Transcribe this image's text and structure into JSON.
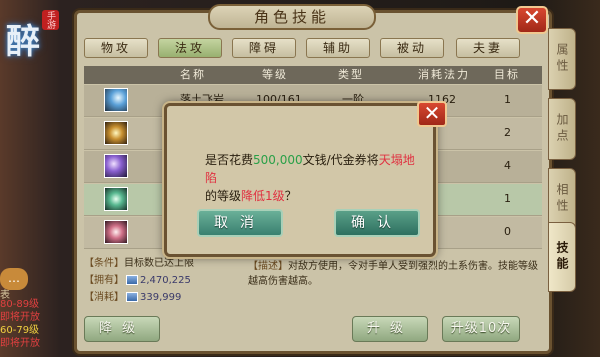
{
  "game": {
    "logo_glyph": "醉",
    "logo_badge": "手游"
  },
  "left": {
    "chat_icon": "…",
    "tab": "表",
    "lines": [
      {
        "text": "80-89级",
        "color": "red"
      },
      {
        "text": "即将开放",
        "color": "red"
      },
      {
        "text": "60-79级",
        "color": "yellow"
      },
      {
        "text": "即将开放",
        "color": "red"
      }
    ]
  },
  "panel": {
    "title": "角色技能",
    "close_glyph": "✕",
    "tabs": [
      "物攻",
      "法攻",
      "障碍",
      "辅助",
      "被动",
      "夫妻"
    ],
    "active_tab": 1,
    "side_tabs": [
      "属性",
      "加点",
      "相性",
      "技能"
    ],
    "active_side_tab": 3,
    "columns": [
      "名称",
      "等级",
      "类型",
      "消耗法力",
      "目标"
    ],
    "rows": [
      {
        "name": "落土飞岩",
        "level": "100/161",
        "type": "一阶",
        "cost": "1162",
        "target": "1"
      },
      {
        "name": "",
        "level": "",
        "type": "",
        "cost": "",
        "target": "2"
      },
      {
        "name": "",
        "level": "",
        "type": "",
        "cost": "",
        "target": "4"
      },
      {
        "name": "",
        "level": "",
        "type": "",
        "cost": "",
        "target": "1"
      },
      {
        "name": "",
        "level": "",
        "type": "",
        "cost": "",
        "target": "0"
      }
    ],
    "condition_label": "【条件】",
    "condition_value": "目标数已达上限",
    "owned_label": "【拥有】",
    "owned_value": "2,470,225",
    "cost_label": "【消耗】",
    "cost_value": "339,999",
    "desc_label": "【描述】",
    "desc_text": "对敌方使用，令对手单人受到强烈的土系伤害。技能等级越高伤害越高。",
    "downgrade_label": "降级",
    "upgrade_label": "升级",
    "upgrade10_label": "升级10次"
  },
  "dialog": {
    "close_glyph": "✕",
    "msg_prefix": "是否花费",
    "amount": "500,000",
    "msg_mid": "文钱/代金券将",
    "skill": "天塌地陷",
    "msg_line2_prefix": "的等级",
    "action": "降低1级",
    "msg_suffix": "？",
    "cancel_label": "取消",
    "confirm_label": "确认"
  },
  "colors": {
    "panel_bg": "#cbc3a8",
    "accent_green": "#2aa048",
    "accent_red": "#e03040",
    "close_red": "#c83820"
  }
}
